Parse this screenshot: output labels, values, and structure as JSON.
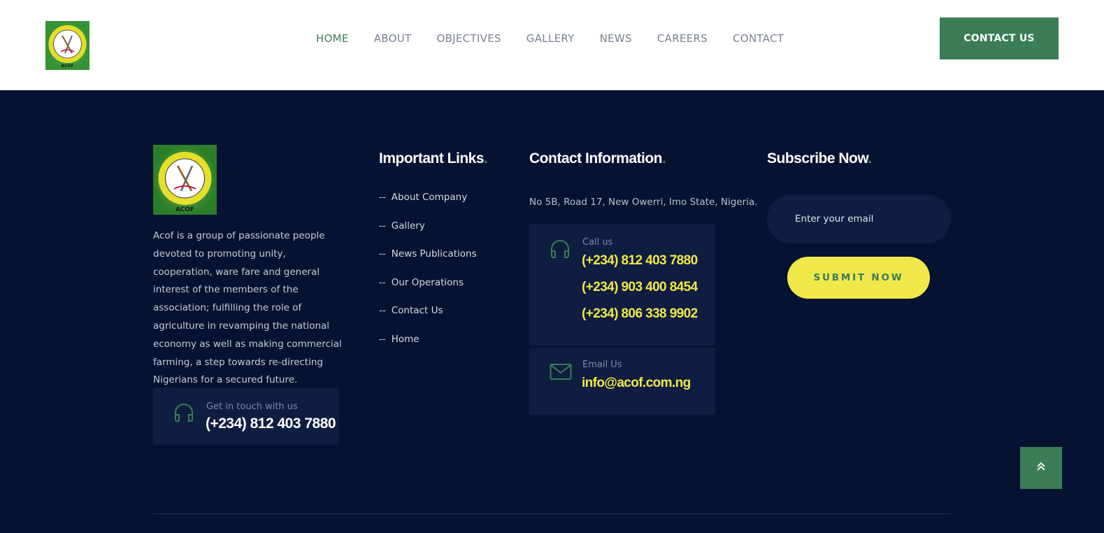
{
  "header": {
    "nav": [
      {
        "label": "HOME",
        "active": true
      },
      {
        "label": "ABOUT"
      },
      {
        "label": "OBJECTIVES"
      },
      {
        "label": "GALLERY"
      },
      {
        "label": "NEWS"
      },
      {
        "label": "CAREERS"
      },
      {
        "label": "CONTACT"
      }
    ],
    "cta_label": "CONTACT US"
  },
  "logo": {
    "ring_text": "ASSOCIATION OF COMMERCIAL FARMERS",
    "country": "NIGERIA",
    "abbr": "ACOF"
  },
  "footer": {
    "about_text": "Acof is a group of passionate people devoted to promoting unity, cooperation, ware fare and general interest of the members of the association; fulfilling the role of agriculture in revamping the national economy as well as making commercial farming, a step towards re-directing Nigerians for a secured future.",
    "touch": {
      "label": "Get in touch with us",
      "phone": "(+234) 812 403 7880"
    },
    "links_title": "Important Links",
    "links": [
      {
        "dash": "--",
        "label": "About Company"
      },
      {
        "dash": "--",
        "label": "Gallery"
      },
      {
        "dash": "--",
        "label": "News Publications"
      },
      {
        "dash": "--",
        "label": "Our Operations"
      },
      {
        "dash": "--",
        "label": "Contact Us"
      },
      {
        "dash": "--",
        "label": "Home"
      }
    ],
    "contact_title": "Contact Information",
    "address": "No 5B, Road 17, New Owerri, Imo State, Nigeria.",
    "call": {
      "label": "Call us",
      "phones": [
        "(+234) 812 403 7880",
        "(+234) 903 400 8454",
        "(+234) 806 338 9902"
      ]
    },
    "email": {
      "label": "Email Us",
      "value": "info@acof.com.ng"
    },
    "subscribe_title": "Subscribe Now",
    "title_dot": ".",
    "email_placeholder": "Enter your email",
    "submit_label": "SUBMIT NOW"
  },
  "colors": {
    "brand_green": "#3b7d57",
    "accent_yellow": "#f0e84a",
    "footer_bg": "#061231",
    "card_bg": "#0f1d40"
  },
  "icons": {
    "headphones": "headphones-icon",
    "mail": "mail-icon",
    "scroll_top": "double-chevron-up-icon"
  }
}
